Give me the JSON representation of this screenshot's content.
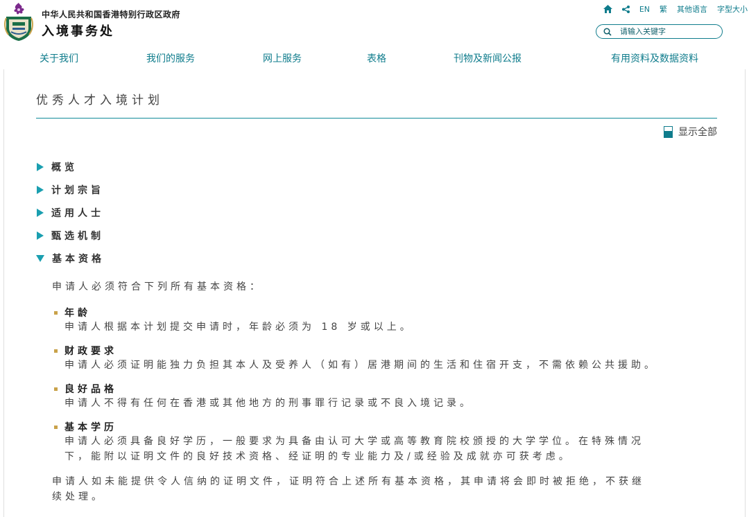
{
  "header": {
    "gov_name": "中华人民共和国香港特别行政区政府",
    "dept_name": "入境事务处",
    "utilities": {
      "lang_en": "EN",
      "lang_trad": "繁",
      "other_lang": "其他语言",
      "font_size": "字型大小"
    },
    "search": {
      "placeholder": "请输入关键字"
    }
  },
  "nav": {
    "items": [
      {
        "label": "关于我们"
      },
      {
        "label": "我们的服务"
      },
      {
        "label": "网上服务"
      },
      {
        "label": "表格"
      },
      {
        "label": "刊物及新闻公报"
      },
      {
        "label": "有用资料及数据资料"
      }
    ]
  },
  "content": {
    "page_title": "优秀人才入境计划",
    "show_all": "显示全部",
    "sections": [
      {
        "label": "概览",
        "expanded": false
      },
      {
        "label": "计划宗旨",
        "expanded": false
      },
      {
        "label": "适用人士",
        "expanded": false
      },
      {
        "label": "甄选机制",
        "expanded": false
      },
      {
        "label": "基本资格",
        "expanded": true
      }
    ],
    "basic": {
      "intro": "申请人必须符合下列所有基本资格：",
      "requirements": [
        {
          "title": "年龄",
          "lines": [
            "申请人根据本计划提交申请时，年龄必须为 18 岁或以上。"
          ]
        },
        {
          "title": "财政要求",
          "lines": [
            "申请人必须证明能独力负担其本人及受养人（如有）居港期间的生活和住宿开支，不需依赖公共援助。"
          ]
        },
        {
          "title": "良好品格",
          "lines": [
            "申请人不得有任何在香港或其他地方的刑事罪行记录或不良入境记录。"
          ]
        },
        {
          "title": "基本学历",
          "lines": [
            "申请人必须具备良好学历，一般要求为具备由认可大学或高等教育院校颁授的大学学位。在特殊情况",
            "下，能附以证明文件的良好技术资格、经证明的专业能力及/或经验及成就亦可获考虑。"
          ]
        }
      ],
      "closing": [
        "申请人如未能提供令人信纳的证明文件，证明符合上述所有基本资格，其申请将会即时被拒绝，不获继",
        "续处理。"
      ]
    }
  },
  "colors": {
    "accent": "#0f7c8c",
    "triangle": "#1a9fb0",
    "bullet": "#c9a24a"
  }
}
